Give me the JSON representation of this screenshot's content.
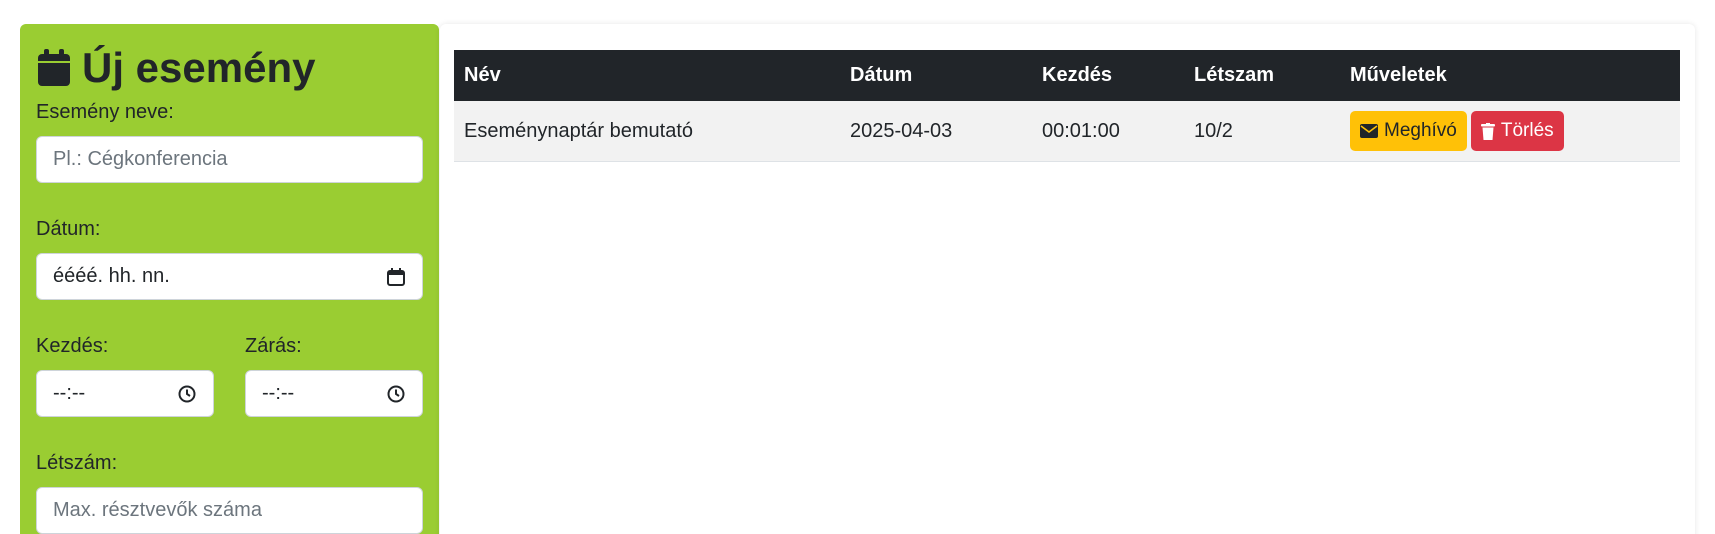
{
  "form": {
    "title": "Új esemény",
    "name_label": "Esemény neve:",
    "name_placeholder": "Pl.: Cégkonferencia",
    "date_label": "Dátum:",
    "date_value": "éééé. hh. nn.",
    "start_label": "Kezdés:",
    "start_value": "--:--",
    "end_label": "Zárás:",
    "end_value": "--:--",
    "capacity_label": "Létszám:",
    "capacity_placeholder": "Max. résztvevők száma"
  },
  "table": {
    "headers": [
      "Név",
      "Dátum",
      "Kezdés",
      "Létszam",
      "Műveletek"
    ],
    "rows": [
      {
        "name": "Eseménynaptár bemutató",
        "date": "2025-04-03",
        "start": "00:01:00",
        "capacity": "10/2",
        "invite_label": "Meghívó",
        "delete_label": "Törlés"
      }
    ]
  },
  "colors": {
    "panel_green": "#9acd32",
    "header_dark": "#212529",
    "warning": "#ffc107",
    "danger": "#dc3545"
  },
  "icons": {
    "title_icon": "calendar-icon",
    "date_icon": "calendar-small-icon",
    "time_icon": "clock-icon",
    "invite_icon": "envelope-icon",
    "delete_icon": "trash-icon"
  }
}
